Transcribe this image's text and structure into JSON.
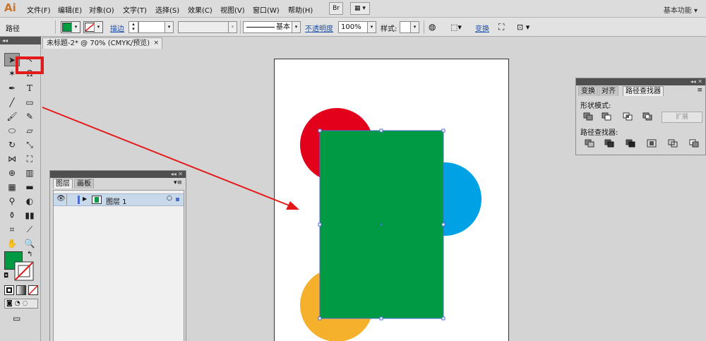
{
  "app": {
    "logo": "Ai",
    "workspace": "基本功能 ▾"
  },
  "menu": [
    "文件(F)",
    "编辑(E)",
    "对象(O)",
    "文字(T)",
    "选择(S)",
    "效果(C)",
    "视图(V)",
    "窗口(W)",
    "帮助(H)"
  ],
  "menubar_buttons": {
    "bridge": "Br"
  },
  "control_bar": {
    "object_type": "路径",
    "stroke_link": "描边",
    "stroke_profile": "基本",
    "opacity_link": "不透明度",
    "opacity_value": "100%",
    "style_label": "样式:",
    "transform_link": "变换",
    "fill_color": "#009a44"
  },
  "document_tab": {
    "title": "未标题-2* @ 70% (CMYK/预览)",
    "close": "×"
  },
  "toolbar": {
    "fill_color": "#009a44",
    "stroke_color": "none"
  },
  "layers_panel": {
    "tabs": [
      "图层",
      "画板"
    ],
    "layer_name": "图层 1"
  },
  "pathfinder_panel": {
    "tabs": [
      "变换",
      "对齐",
      "路径查找器"
    ],
    "shape_modes_label": "形状模式:",
    "expand_label": "扩展",
    "pathfinders_label": "路径查找器:"
  },
  "artwork": {
    "rectangle_color": "#009a44",
    "red_circle_color": "#e3001b",
    "blue_circle_color": "#00a1e5",
    "yellow_circle_color": "#f5b12c",
    "selection_color": "#4a6fd0",
    "arrow_color": "#e41a1a"
  }
}
